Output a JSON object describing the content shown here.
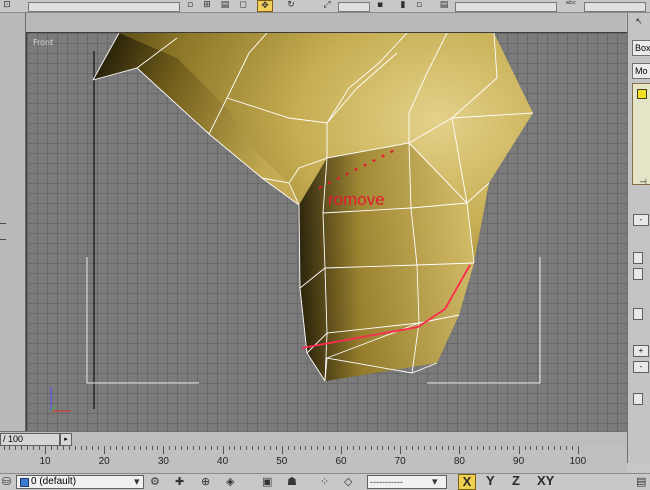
{
  "viewport": {
    "label": "Front",
    "annotation": "romove"
  },
  "right_panel": {
    "object_field": "Box",
    "modifier_field": "Mo",
    "btn_minus_1": "-",
    "btn_plus": "+",
    "btn_minus_2": "-"
  },
  "timeline": {
    "frame_display": "/ 100",
    "next_arrow": "▸",
    "ruler_labels": [
      "10",
      "20",
      "30",
      "40",
      "50",
      "60",
      "70",
      "80",
      "90",
      "100"
    ]
  },
  "status": {
    "layer_name": "0 (default)",
    "selection_dropdown": "-----------",
    "axis_x": "X",
    "axis_y": "Y",
    "axis_z": "Z",
    "axis_xy": "XY"
  },
  "colors": {
    "annotation": "#e51a30",
    "active_button": "#f0d050"
  }
}
